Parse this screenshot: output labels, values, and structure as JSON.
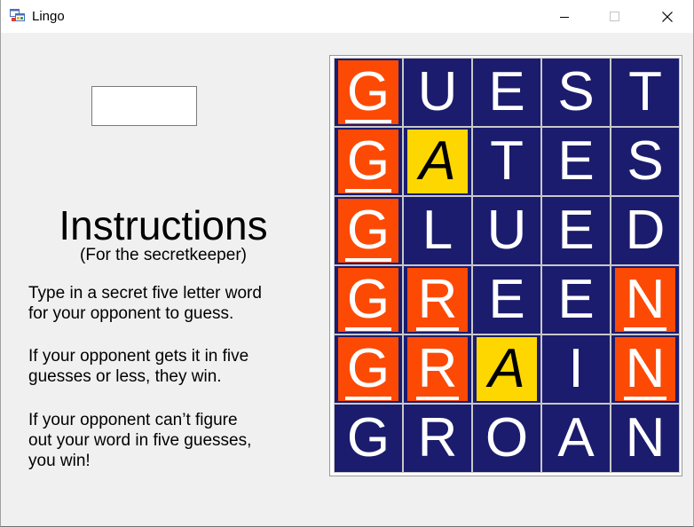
{
  "window": {
    "title": "Lingo",
    "icon": "windows-forms-app-icon",
    "controls": [
      "minimize-icon",
      "maximize-icon",
      "close-icon"
    ]
  },
  "secret_input": {
    "value": "",
    "placeholder": ""
  },
  "instructions": {
    "title": "Instructions",
    "subtitle": "(For the secretkeeper)",
    "paragraphs": [
      [
        "Type in a secret five letter word",
        "for your opponent to guess."
      ],
      [
        "If your opponent gets it in five",
        "guesses or less, they win."
      ],
      [
        "If your opponent can’t figure",
        "out your word in five guesses,",
        "you win!"
      ]
    ]
  },
  "colors": {
    "tile_blue": "#1b1c6d",
    "tile_red": "#fc4a05",
    "tile_yellow": "#ffd700",
    "grid_line": "#c8c8c8"
  },
  "board": {
    "rows": [
      [
        {
          "letter": "G",
          "state": "red"
        },
        {
          "letter": "U",
          "state": "blue"
        },
        {
          "letter": "E",
          "state": "blue"
        },
        {
          "letter": "S",
          "state": "blue"
        },
        {
          "letter": "T",
          "state": "blue"
        }
      ],
      [
        {
          "letter": "G",
          "state": "red"
        },
        {
          "letter": "A",
          "state": "yellow"
        },
        {
          "letter": "T",
          "state": "blue"
        },
        {
          "letter": "E",
          "state": "blue"
        },
        {
          "letter": "S",
          "state": "blue"
        }
      ],
      [
        {
          "letter": "G",
          "state": "red"
        },
        {
          "letter": "L",
          "state": "blue"
        },
        {
          "letter": "U",
          "state": "blue"
        },
        {
          "letter": "E",
          "state": "blue"
        },
        {
          "letter": "D",
          "state": "blue"
        }
      ],
      [
        {
          "letter": "G",
          "state": "red"
        },
        {
          "letter": "R",
          "state": "red"
        },
        {
          "letter": "E",
          "state": "blue"
        },
        {
          "letter": "E",
          "state": "blue"
        },
        {
          "letter": "N",
          "state": "red"
        }
      ],
      [
        {
          "letter": "G",
          "state": "red"
        },
        {
          "letter": "R",
          "state": "red"
        },
        {
          "letter": "A",
          "state": "yellow"
        },
        {
          "letter": "I",
          "state": "blue"
        },
        {
          "letter": "N",
          "state": "red"
        }
      ],
      [
        {
          "letter": "G",
          "state": "blue"
        },
        {
          "letter": "R",
          "state": "blue"
        },
        {
          "letter": "O",
          "state": "blue"
        },
        {
          "letter": "A",
          "state": "blue"
        },
        {
          "letter": "N",
          "state": "blue"
        }
      ]
    ]
  }
}
